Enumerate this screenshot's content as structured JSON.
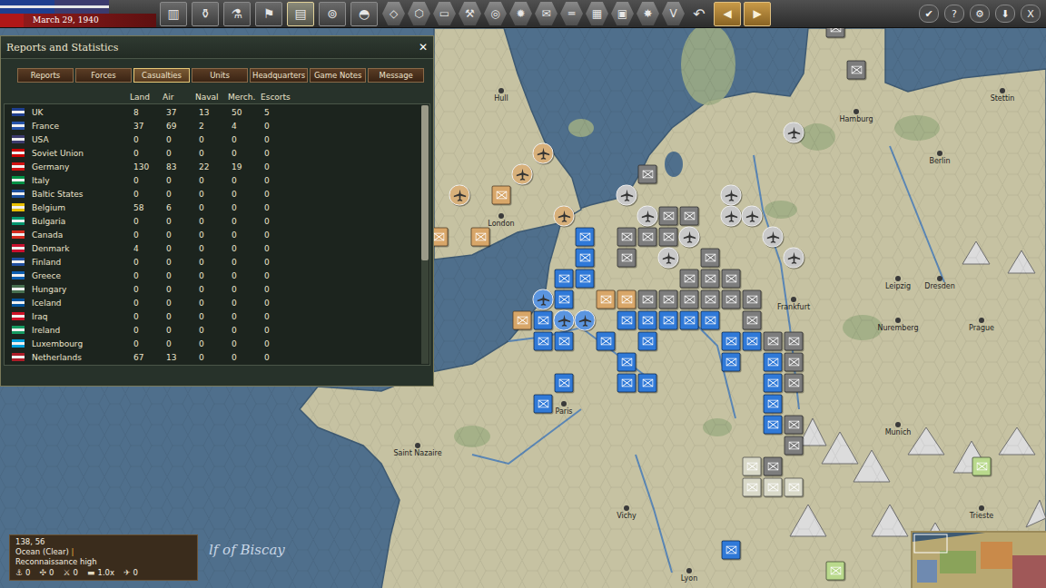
{
  "top_bar": {
    "flags": [
      {
        "color": "#1f3f8f"
      },
      {
        "color": "#3c3b6e"
      },
      {
        "color": "#b01818"
      }
    ],
    "date": "March 29, 1940",
    "toolbar": [
      {
        "glyph": "▥",
        "kind": "square",
        "selected": false
      },
      {
        "glyph": "⚱",
        "kind": "square",
        "selected": false
      },
      {
        "glyph": "⚗",
        "kind": "square",
        "selected": false
      },
      {
        "glyph": "⚑",
        "kind": "square",
        "selected": false
      },
      {
        "glyph": "▤",
        "kind": "square",
        "selected": true
      },
      {
        "glyph": "⊚",
        "kind": "square",
        "selected": false
      },
      {
        "glyph": "◓",
        "kind": "square",
        "selected": false
      },
      {
        "glyph": "◇",
        "kind": "hex",
        "selected": false
      },
      {
        "glyph": "⬡",
        "kind": "hex",
        "selected": false
      },
      {
        "glyph": "▭",
        "kind": "hex",
        "selected": false
      },
      {
        "glyph": "⚒",
        "kind": "hex",
        "selected": false
      },
      {
        "glyph": "◎",
        "kind": "hex",
        "selected": false
      },
      {
        "glyph": "✹",
        "kind": "hex",
        "selected": false
      },
      {
        "glyph": "✉",
        "kind": "hex",
        "selected": false
      },
      {
        "glyph": "═",
        "kind": "hex",
        "selected": false
      },
      {
        "glyph": "▦",
        "kind": "hex",
        "selected": false
      },
      {
        "glyph": "▣",
        "kind": "hex",
        "selected": false
      },
      {
        "glyph": "✸",
        "kind": "hex",
        "selected": false
      },
      {
        "glyph": "V",
        "kind": "hex",
        "selected": false
      },
      {
        "glyph": "↶",
        "kind": "plain",
        "selected": false
      },
      {
        "glyph": "◀",
        "kind": "arrow",
        "selected": false
      },
      {
        "glyph": "▶",
        "kind": "arrow",
        "selected": false
      }
    ],
    "controls": [
      {
        "glyph": "✔"
      },
      {
        "glyph": "?"
      },
      {
        "glyph": "⚙"
      },
      {
        "glyph": "⬇"
      },
      {
        "glyph": "X"
      }
    ]
  },
  "panel": {
    "title": "Reports and Statistics",
    "close": "✕",
    "tabs": [
      {
        "label": "Reports",
        "selected": false
      },
      {
        "label": "Forces",
        "selected": false
      },
      {
        "label": "Casualties",
        "selected": true
      },
      {
        "label": "Units",
        "selected": false
      },
      {
        "label": "Headquarters",
        "selected": false
      },
      {
        "label": "Game Notes",
        "selected": false
      },
      {
        "label": "Message",
        "selected": false
      }
    ],
    "columns": [
      "Land",
      "Air",
      "Naval",
      "Merch.",
      "Escorts"
    ],
    "rows": [
      {
        "country": "UK",
        "color": "#1f3f8f",
        "values": [
          "8",
          "37",
          "13",
          "50",
          "5"
        ]
      },
      {
        "country": "France",
        "color": "#2553a8",
        "values": [
          "37",
          "69",
          "2",
          "4",
          "0"
        ]
      },
      {
        "country": "USA",
        "color": "#3c3b6e",
        "values": [
          "0",
          "0",
          "0",
          "0",
          "0"
        ]
      },
      {
        "country": "Soviet Union",
        "color": "#cc0000",
        "values": [
          "0",
          "0",
          "0",
          "0",
          "0"
        ]
      },
      {
        "country": "Germany",
        "color": "#d01010",
        "values": [
          "130",
          "83",
          "22",
          "19",
          "0"
        ]
      },
      {
        "country": "Italy",
        "color": "#009246",
        "values": [
          "0",
          "0",
          "0",
          "0",
          "0"
        ]
      },
      {
        "country": "Baltic States",
        "color": "#1b4f9c",
        "values": [
          "0",
          "0",
          "0",
          "0",
          "0"
        ]
      },
      {
        "country": "Belgium",
        "color": "#e8c000",
        "values": [
          "58",
          "6",
          "0",
          "0",
          "0"
        ]
      },
      {
        "country": "Bulgaria",
        "color": "#00966e",
        "values": [
          "0",
          "0",
          "0",
          "0",
          "0"
        ]
      },
      {
        "country": "Canada",
        "color": "#d52b1e",
        "values": [
          "0",
          "0",
          "0",
          "0",
          "0"
        ]
      },
      {
        "country": "Denmark",
        "color": "#c8102e",
        "values": [
          "4",
          "0",
          "0",
          "0",
          "0"
        ]
      },
      {
        "country": "Finland",
        "color": "#1f4fa0",
        "values": [
          "0",
          "0",
          "0",
          "0",
          "0"
        ]
      },
      {
        "country": "Greece",
        "color": "#0d5eaf",
        "values": [
          "0",
          "0",
          "0",
          "0",
          "0"
        ]
      },
      {
        "country": "Hungary",
        "color": "#477050",
        "values": [
          "0",
          "0",
          "0",
          "0",
          "0"
        ]
      },
      {
        "country": "Iceland",
        "color": "#02529c",
        "values": [
          "0",
          "0",
          "0",
          "0",
          "0"
        ]
      },
      {
        "country": "Iraq",
        "color": "#ce1126",
        "values": [
          "0",
          "0",
          "0",
          "0",
          "0"
        ]
      },
      {
        "country": "Ireland",
        "color": "#169b62",
        "values": [
          "0",
          "0",
          "0",
          "0",
          "0"
        ]
      },
      {
        "country": "Luxembourg",
        "color": "#00a1de",
        "values": [
          "0",
          "0",
          "0",
          "0",
          "0"
        ]
      },
      {
        "country": "Netherlands",
        "color": "#ae1c28",
        "values": [
          "67",
          "13",
          "0",
          "0",
          "0"
        ]
      }
    ],
    "scroll": {
      "level": 0.6
    }
  },
  "map": {
    "cities": [
      {
        "name": "Hull",
        "hex": [
          24,
          3
        ]
      },
      {
        "name": "London",
        "hex": [
          24,
          9
        ]
      },
      {
        "name": "Paris",
        "hex": [
          27,
          18
        ]
      },
      {
        "name": "Frankfurt",
        "hex": [
          38,
          13
        ]
      },
      {
        "name": "Hamburg",
        "hex": [
          41,
          4
        ]
      },
      {
        "name": "Berlin",
        "hex": [
          45,
          6
        ]
      },
      {
        "name": "Stettin",
        "hex": [
          48,
          3
        ]
      },
      {
        "name": "Leipzig",
        "hex": [
          43,
          12
        ]
      },
      {
        "name": "Dresden",
        "hex": [
          45,
          12
        ]
      },
      {
        "name": "Nuremberg",
        "hex": [
          43,
          14
        ]
      },
      {
        "name": "Prague",
        "hex": [
          47,
          14
        ]
      },
      {
        "name": "Munich",
        "hex": [
          43,
          19
        ]
      },
      {
        "name": "Saint Nazaire",
        "hex": [
          20,
          20
        ]
      },
      {
        "name": "Vichy",
        "hex": [
          30,
          23
        ]
      },
      {
        "name": "Lyon",
        "hex": [
          33,
          26
        ]
      },
      {
        "name": "Trieste",
        "hex": [
          47,
          23
        ]
      }
    ],
    "sea_labels": [
      {
        "name": "lf of Biscay",
        "hex": [
          10,
          25
        ]
      }
    ],
    "units": [
      {
        "kind": "army",
        "color": "#2f79d8",
        "hex": [
          28,
          10
        ]
      },
      {
        "kind": "army",
        "color": "#2f79d8",
        "hex": [
          28,
          11
        ]
      },
      {
        "kind": "army",
        "color": "#2f79d8",
        "hex": [
          28,
          12
        ]
      },
      {
        "kind": "army",
        "color": "#2f79d8",
        "hex": [
          27,
          12
        ]
      },
      {
        "kind": "army",
        "color": "#2f79d8",
        "hex": [
          27,
          13
        ]
      },
      {
        "kind": "army",
        "color": "#2f79d8",
        "hex": [
          26,
          14
        ]
      },
      {
        "kind": "army",
        "color": "#2f79d8",
        "hex": [
          27,
          15
        ]
      },
      {
        "kind": "army",
        "color": "#2f79d8",
        "hex": [
          26,
          15
        ]
      },
      {
        "kind": "army",
        "color": "#2f79d8",
        "hex": [
          29,
          15
        ]
      },
      {
        "kind": "army",
        "color": "#2f79d8",
        "hex": [
          30,
          14
        ]
      },
      {
        "kind": "army",
        "color": "#2f79d8",
        "hex": [
          31,
          14
        ]
      },
      {
        "kind": "army",
        "color": "#2f79d8",
        "hex": [
          31,
          15
        ]
      },
      {
        "kind": "army",
        "color": "#2f79d8",
        "hex": [
          32,
          14
        ]
      },
      {
        "kind": "army",
        "color": "#2f79d8",
        "hex": [
          33,
          14
        ]
      },
      {
        "kind": "army",
        "color": "#2f79d8",
        "hex": [
          34,
          14
        ]
      },
      {
        "kind": "army",
        "color": "#2f79d8",
        "hex": [
          35,
          15
        ]
      },
      {
        "kind": "army",
        "color": "#2f79d8",
        "hex": [
          36,
          15
        ]
      },
      {
        "kind": "army",
        "color": "#2f79d8",
        "hex": [
          35,
          16
        ]
      },
      {
        "kind": "army",
        "color": "#2f79d8",
        "hex": [
          37,
          16
        ]
      },
      {
        "kind": "army",
        "color": "#2f79d8",
        "hex": [
          37,
          17
        ]
      },
      {
        "kind": "army",
        "color": "#2f79d8",
        "hex": [
          37,
          18
        ]
      },
      {
        "kind": "army",
        "color": "#2f79d8",
        "hex": [
          37,
          19
        ]
      },
      {
        "kind": "army",
        "color": "#2f79d8",
        "hex": [
          30,
          17
        ]
      },
      {
        "kind": "army",
        "color": "#2f79d8",
        "hex": [
          31,
          17
        ]
      },
      {
        "kind": "army",
        "color": "#2f79d8",
        "hex": [
          27,
          17
        ]
      },
      {
        "kind": "army",
        "color": "#2f79d8",
        "hex": [
          26,
          18
        ]
      },
      {
        "kind": "army",
        "color": "#2f79d8",
        "hex": [
          30,
          16
        ]
      },
      {
        "kind": "army",
        "color": "#2f79d8",
        "hex": [
          35,
          25
        ]
      },
      {
        "kind": "army",
        "color": "#7d7d7d",
        "hex": [
          31,
          7
        ]
      },
      {
        "kind": "army",
        "color": "#7d7d7d",
        "hex": [
          32,
          9
        ]
      },
      {
        "kind": "army",
        "color": "#7d7d7d",
        "hex": [
          30,
          10
        ]
      },
      {
        "kind": "army",
        "color": "#7d7d7d",
        "hex": [
          31,
          10
        ]
      },
      {
        "kind": "army",
        "color": "#7d7d7d",
        "hex": [
          32,
          10
        ]
      },
      {
        "kind": "army",
        "color": "#7d7d7d",
        "hex": [
          33,
          12
        ]
      },
      {
        "kind": "army",
        "color": "#7d7d7d",
        "hex": [
          30,
          11
        ]
      },
      {
        "kind": "army",
        "color": "#7d7d7d",
        "hex": [
          31,
          13
        ]
      },
      {
        "kind": "army",
        "color": "#7d7d7d",
        "hex": [
          32,
          13
        ]
      },
      {
        "kind": "army",
        "color": "#7d7d7d",
        "hex": [
          33,
          13
        ]
      },
      {
        "kind": "army",
        "color": "#7d7d7d",
        "hex": [
          34,
          13
        ]
      },
      {
        "kind": "army",
        "color": "#7d7d7d",
        "hex": [
          35,
          13
        ]
      },
      {
        "kind": "army",
        "color": "#7d7d7d",
        "hex": [
          36,
          13
        ]
      },
      {
        "kind": "army",
        "color": "#7d7d7d",
        "hex": [
          34,
          12
        ]
      },
      {
        "kind": "army",
        "color": "#7d7d7d",
        "hex": [
          35,
          12
        ]
      },
      {
        "kind": "army",
        "color": "#7d7d7d",
        "hex": [
          33,
          9
        ]
      },
      {
        "kind": "army",
        "color": "#7d7d7d",
        "hex": [
          34,
          11
        ]
      },
      {
        "kind": "army",
        "color": "#7d7d7d",
        "hex": [
          36,
          14
        ]
      },
      {
        "kind": "army",
        "color": "#7d7d7d",
        "hex": [
          37,
          15
        ]
      },
      {
        "kind": "army",
        "color": "#7d7d7d",
        "hex": [
          38,
          15
        ]
      },
      {
        "kind": "army",
        "color": "#7d7d7d",
        "hex": [
          38,
          16
        ]
      },
      {
        "kind": "army",
        "color": "#7d7d7d",
        "hex": [
          38,
          17
        ]
      },
      {
        "kind": "army",
        "color": "#7d7d7d",
        "hex": [
          38,
          19
        ]
      },
      {
        "kind": "army",
        "color": "#7d7d7d",
        "hex": [
          38,
          20
        ]
      },
      {
        "kind": "army",
        "color": "#7d7d7d",
        "hex": [
          37,
          21
        ]
      },
      {
        "kind": "army",
        "color": "#7d7d7d",
        "hex": [
          40,
          0
        ]
      },
      {
        "kind": "army",
        "color": "#7d7d7d",
        "hex": [
          41,
          2
        ]
      },
      {
        "kind": "army",
        "color": "#d9d9c8",
        "hex": [
          36,
          21
        ]
      },
      {
        "kind": "army",
        "color": "#d9d9c8",
        "hex": [
          36,
          22
        ]
      },
      {
        "kind": "army",
        "color": "#d9d9c8",
        "hex": [
          37,
          22
        ]
      },
      {
        "kind": "army",
        "color": "#d9d9c8",
        "hex": [
          38,
          22
        ]
      },
      {
        "kind": "army",
        "color": "#d8a668",
        "hex": [
          24,
          8
        ]
      },
      {
        "kind": "army",
        "color": "#d8a668",
        "hex": [
          23,
          10
        ]
      },
      {
        "kind": "army",
        "color": "#d8a668",
        "hex": [
          21,
          10
        ]
      },
      {
        "kind": "army",
        "color": "#d8a668",
        "hex": [
          25,
          14
        ]
      },
      {
        "kind": "army",
        "color": "#d8a668",
        "hex": [
          29,
          13
        ]
      },
      {
        "kind": "army",
        "color": "#d8a668",
        "hex": [
          30,
          13
        ]
      },
      {
        "kind": "army",
        "color": "#b9d98c",
        "hex": [
          47,
          21
        ]
      },
      {
        "kind": "army",
        "color": "#b9d98c",
        "hex": [
          40,
          26
        ]
      },
      {
        "kind": "air",
        "color": "#c9c9c9",
        "hex": [
          30,
          8
        ]
      },
      {
        "kind": "air",
        "color": "#c9c9c9",
        "hex": [
          31,
          9
        ]
      },
      {
        "kind": "air",
        "color": "#c9c9c9",
        "hex": [
          32,
          11
        ]
      },
      {
        "kind": "air",
        "color": "#c9c9c9",
        "hex": [
          33,
          10
        ]
      },
      {
        "kind": "air",
        "color": "#c9c9c9",
        "hex": [
          35,
          8
        ]
      },
      {
        "kind": "air",
        "color": "#c9c9c9",
        "hex": [
          35,
          9
        ]
      },
      {
        "kind": "air",
        "color": "#c9c9c9",
        "hex": [
          36,
          9
        ]
      },
      {
        "kind": "air",
        "color": "#c9c9c9",
        "hex": [
          37,
          10
        ]
      },
      {
        "kind": "air",
        "color": "#c9c9c9",
        "hex": [
          38,
          11
        ]
      },
      {
        "kind": "air",
        "color": "#c9c9c9",
        "hex": [
          38,
          5
        ]
      },
      {
        "kind": "air",
        "color": "#5b95e0",
        "hex": [
          26,
          13
        ]
      },
      {
        "kind": "air",
        "color": "#5b95e0",
        "hex": [
          27,
          14
        ]
      },
      {
        "kind": "air",
        "color": "#5b95e0",
        "hex": [
          28,
          14
        ]
      },
      {
        "kind": "air",
        "color": "#d8b07a",
        "hex": [
          25,
          7
        ]
      },
      {
        "kind": "air",
        "color": "#d8b07a",
        "hex": [
          26,
          6
        ]
      },
      {
        "kind": "air",
        "color": "#d8b07a",
        "hex": [
          22,
          8
        ]
      },
      {
        "kind": "air",
        "color": "#d8b07a",
        "hex": [
          27,
          9
        ]
      }
    ]
  },
  "info_box": {
    "coords": "138, 56",
    "terrain": "Ocean (Clear)",
    "separator": "|",
    "recon": "Reconnaissance high",
    "stats": [
      {
        "glyph": "⚓",
        "value": "0"
      },
      {
        "glyph": "✣",
        "value": "0"
      },
      {
        "glyph": "⚔",
        "value": "0"
      },
      {
        "glyph": "▬",
        "value": "1.0x"
      },
      {
        "glyph": "✈",
        "value": "0"
      }
    ]
  }
}
